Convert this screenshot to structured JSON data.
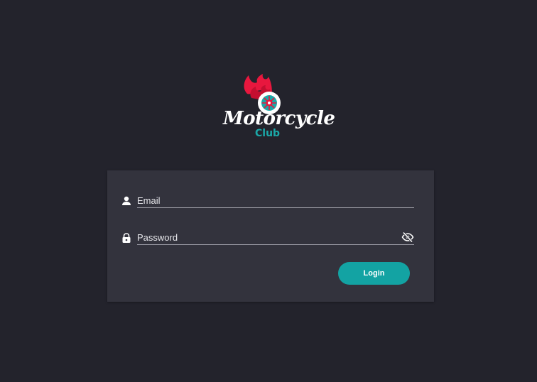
{
  "logo": {
    "title": "Motorcycle",
    "subtitle": "Club"
  },
  "form": {
    "email": {
      "placeholder": "Email",
      "value": "",
      "icon": "person-icon"
    },
    "password": {
      "placeholder": "Password",
      "value": "",
      "icon": "lock-icon",
      "toggle_icon": "eye-off-icon"
    },
    "login_label": "Login"
  },
  "colors": {
    "background": "#23232c",
    "card": "#33333d",
    "accent": "#13a3a3",
    "brand_red": "#e8173e"
  }
}
